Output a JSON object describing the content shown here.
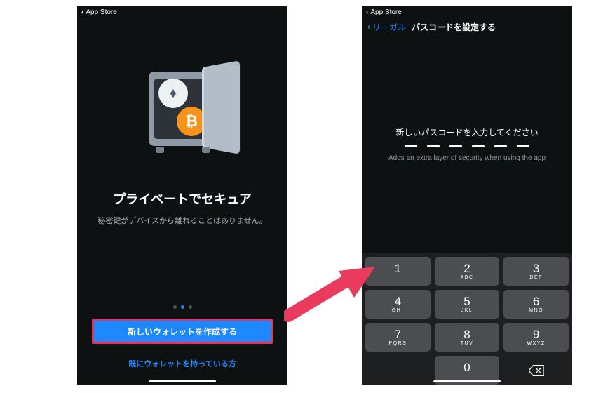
{
  "left": {
    "status_back": "App Store",
    "heading": "プライベートでセキュア",
    "sub": "秘密鍵がデバイスから離れることはありません。",
    "primary": "新しいウォレットを作成する",
    "secondary": "既にウォレットを持っている方",
    "tokens": {
      "eth": "♦",
      "btc": "₿"
    },
    "page_dots": {
      "count": 3,
      "active": 1
    }
  },
  "right": {
    "status_back": "App Store",
    "nav_back": "リーガル",
    "nav_title": "パスコードを設定する",
    "prompt": "新しいパスコードを入力してください",
    "help": "Adds an extra layer of security when using the app",
    "passcode_length": 6,
    "keys": [
      {
        "d": "1",
        "l": ""
      },
      {
        "d": "2",
        "l": "ABC"
      },
      {
        "d": "3",
        "l": "DEF"
      },
      {
        "d": "4",
        "l": "GHI"
      },
      {
        "d": "5",
        "l": "JKL"
      },
      {
        "d": "6",
        "l": "MNO"
      },
      {
        "d": "7",
        "l": "PQRS"
      },
      {
        "d": "8",
        "l": "TUV"
      },
      {
        "d": "9",
        "l": "WXYZ"
      },
      {
        "d": "",
        "l": "",
        "blank": true
      },
      {
        "d": "0",
        "l": ""
      },
      {
        "d": "",
        "l": "",
        "backspace": true
      }
    ]
  }
}
